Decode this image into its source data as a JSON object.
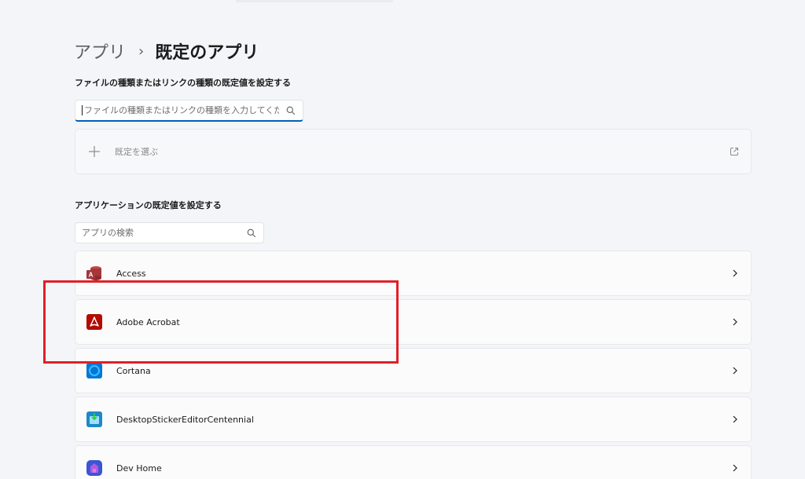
{
  "breadcrumb": {
    "parent": "アプリ",
    "separator": "›",
    "current": "既定のアプリ"
  },
  "file_type_section": {
    "heading": "ファイルの種類またはリンクの種類の既定値を設定する",
    "search_placeholder": "ファイルの種類またはリンクの種類を入力してください",
    "choose_default_label": "既定を選ぶ"
  },
  "app_section": {
    "heading": "アプリケーションの既定値を設定する",
    "search_placeholder": "アプリの検索",
    "apps": [
      {
        "name": "Access",
        "icon": "access-icon",
        "color": "#a4373a"
      },
      {
        "name": "Adobe Acrobat",
        "icon": "adobe-acrobat-icon",
        "color": "#b30b00"
      },
      {
        "name": "Cortana",
        "icon": "cortana-icon",
        "color": "#0078d4"
      },
      {
        "name": "DesktopStickerEditorCentennial",
        "icon": "sticker-editor-icon",
        "color": "#1e88c8"
      },
      {
        "name": "Dev Home",
        "icon": "dev-home-icon",
        "color": "#5b3cc4"
      }
    ]
  },
  "colors": {
    "accent": "#005fb8",
    "highlight": "#e0202a",
    "background": "#f3f5f9"
  }
}
